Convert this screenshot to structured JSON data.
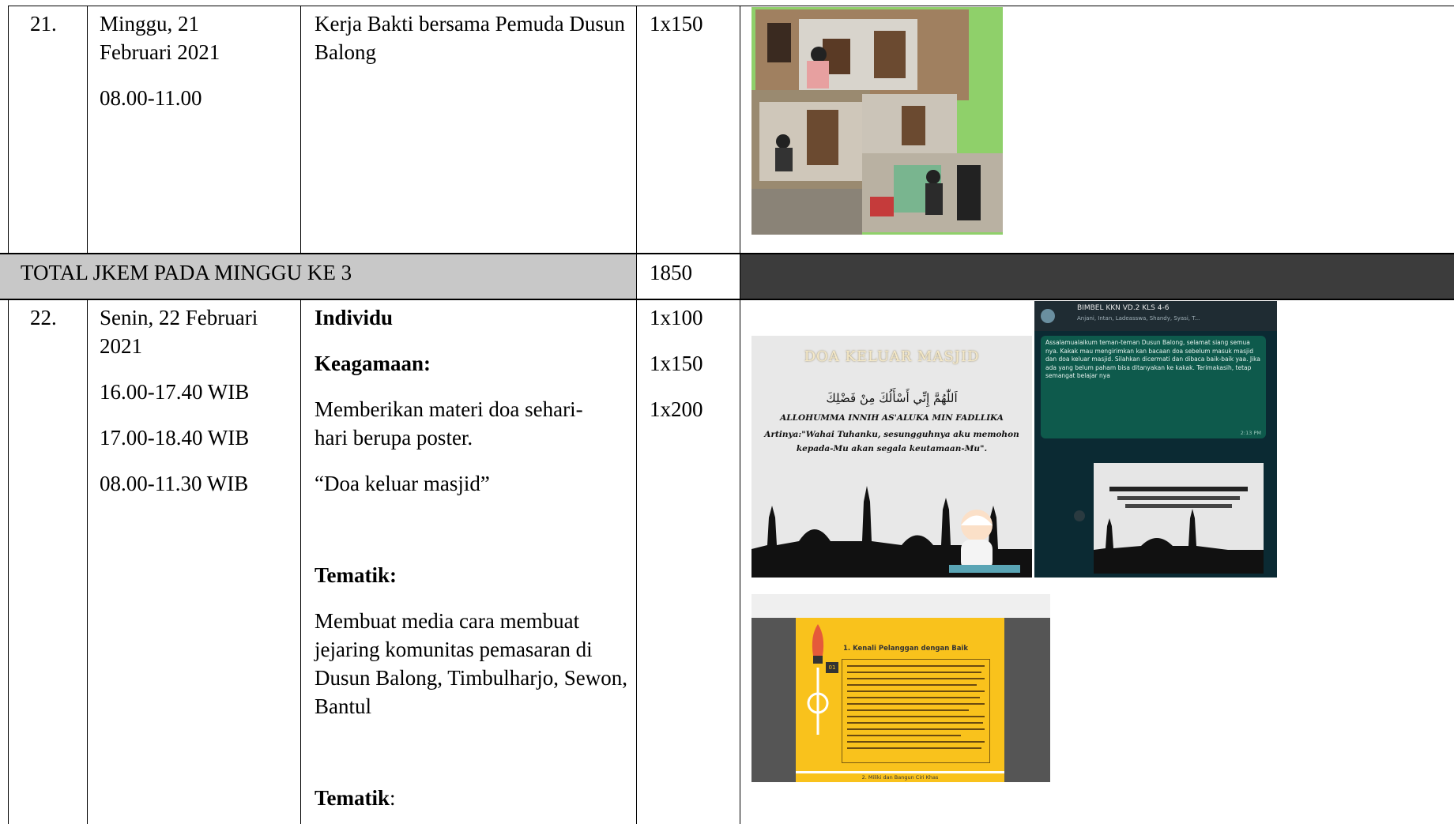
{
  "rows": [
    {
      "no": "21.",
      "date_lines": [
        "Minggu, 21",
        "Februari 2021"
      ],
      "time": "08.00-11.00",
      "activity": "Kerja Bakti bersama Pemuda Dusun Balong",
      "jkem": "1x150"
    },
    {
      "no": "22.",
      "date_lines": [
        "Senin, 22 Februari",
        "2021"
      ],
      "times": [
        "16.00-17.40 WIB",
        "17.00-18.40 WIB",
        "08.00-11.30 WIB"
      ],
      "activity": {
        "individu": "Individu",
        "keagamaan_heading": "Keagamaan:",
        "keagamaan_desc": "Memberikan materi doa sehari-hari berupa poster.",
        "quote": "“Doa keluar masjid”",
        "tematik_heading_1": "Tematik:",
        "tematik_desc": "Membuat media cara membuat jejaring komunitas pemasaran di Dusun Balong, Timbulharjo, Sewon, Bantul",
        "tematik_heading_2": "Tematik",
        "tematik_heading_2_colon": ":"
      },
      "jkem": [
        "1x100",
        "1x150",
        "1x200"
      ]
    }
  ],
  "total": {
    "label": "TOTAL JKEM PADA MINGGU KE 3",
    "value": "1850"
  },
  "poster": {
    "title": "DOA KELUAR MASJID",
    "arabic": "اَللّٰهُمَّ إِنِّي أَسْأَلُكَ مِنْ فَضْلِكَ",
    "latin": "ALLOHUMMA INNIH AS'ALUKA MIN FADLLIKA",
    "meaning": "Artinya:\"Wahai Tuhanku, sesungguhnya aku memohon kepada-Mu akan segala keutamaan-Mu\"."
  },
  "chat": {
    "group_name": "BIMBEL KKN VD.2 KLS 4-6",
    "members": "Anjani, Intan, Ladeasswa, Shandy, Syasi, T...",
    "message": "Assalamualaikum teman-teman Dusun Balong, selamat siang semua nya. Kakak mau mengirimkan kan bacaan doa sebelum masuk masjid dan doa keluar masjid. Silahkan dicermati dan dibaca baik-baik yaa. Jika ada yang belum paham bisa ditanyakan ke kakak. Terimakasih, tetap semangat belajar nya",
    "time": "2:13 PM"
  },
  "slide": {
    "heading": "1. Kenali Pelanggan dengan Baik",
    "footer": "2. Miliki dan Bangun Ciri Khas",
    "badge": "01"
  },
  "colors": {
    "total_row": "#c8c8c8",
    "dark_cell": "#3c3c3c",
    "slide_yellow": "#f9c21c",
    "chat_bg": "#0b2a33",
    "chat_bubble": "#0e5a4c"
  }
}
